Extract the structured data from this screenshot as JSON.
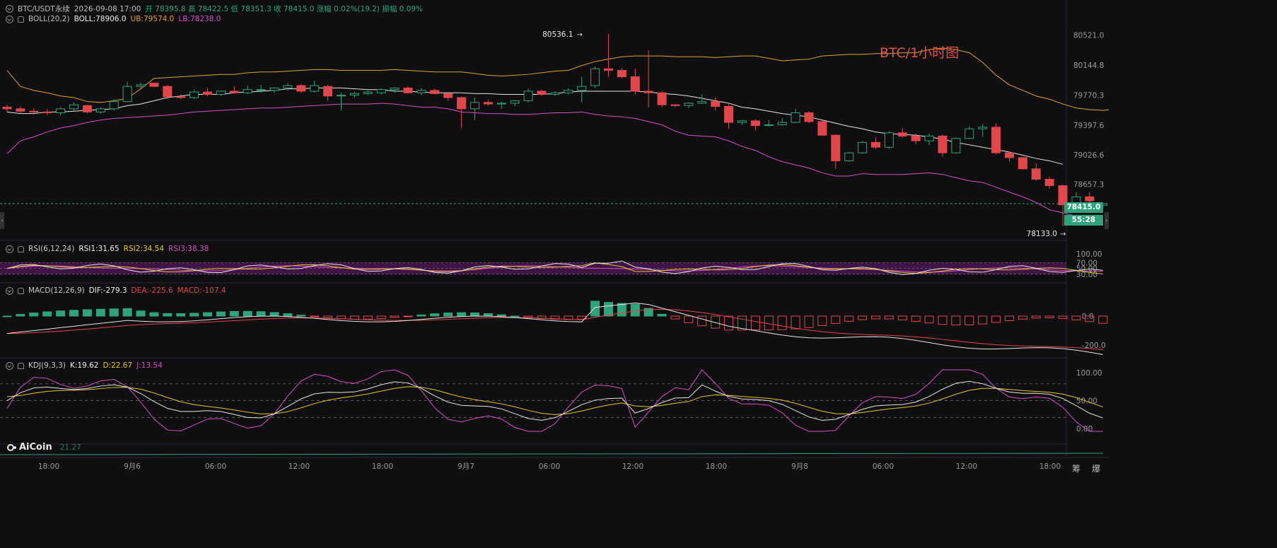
{
  "header": {
    "symbol": "BTC/USDT永续",
    "datetime": "2026-09-08 17:00",
    "ohlc_text": "开 78395.8 高 78422.5 低 78351.3 收 78415.0 涨幅 0.02%(19.2) 振幅 0.09%",
    "boll_label": "BOLL(20,2)",
    "boll_mid": "BOLL:78906.0",
    "boll_ub": "UB:79574.0",
    "boll_lb": "LB:78238.0"
  },
  "chart_title": "BTC/1小时图",
  "annotations": {
    "high": "80536.1",
    "low": "78133.0"
  },
  "price_axis_labels": [
    "80521.0",
    "80144.8",
    "79770.3",
    "79397.6",
    "79026.6",
    "78657.3"
  ],
  "current_price": "78415.0",
  "countdown": "55:28",
  "rsi": {
    "label": "RSI(6,12,24)",
    "v1": "RSI1:31.65",
    "v2": "RSI2:34.54",
    "v3": "RSI3:38.38",
    "axis": [
      "100.00",
      "70.00",
      "50.00",
      "30.00"
    ]
  },
  "macd": {
    "label": "MACD(12,26,9)",
    "dif": "DIF:-279.3",
    "dea": "DEA:-225.6",
    "macd": "MACD:-107.4",
    "axis": [
      "0.0",
      "-200.0"
    ]
  },
  "kdj": {
    "label": "KDJ(9,3,3)",
    "k": "K:19.62",
    "d": "D:22.67",
    "j": "J:13.54",
    "axis": [
      "100.00",
      "50.00",
      "0.00"
    ]
  },
  "bottom_indicator_value": "21.27",
  "time_axis": [
    "18:00",
    "9月6",
    "06:00",
    "12:00",
    "18:00",
    "9月7",
    "06:00",
    "12:00",
    "18:00",
    "9月8",
    "06:00",
    "12:00",
    "18:00"
  ],
  "logo_text": "AiCoin",
  "bottom_right_text": "筹 爆",
  "colors": {
    "up": "#2fa37a",
    "down": "#e0474c",
    "ub": "#e2a02f",
    "mid": "#e6e6e6",
    "lb": "#d74fc2",
    "rsi_band": "#4a1550"
  },
  "chart_data": {
    "type": "candlestick",
    "interval": "1h",
    "ylim": [
      78000,
      80650
    ],
    "candles": [
      [
        79620,
        79650,
        79560,
        79600
      ],
      [
        79600,
        79630,
        79540,
        79570
      ],
      [
        79570,
        79610,
        79530,
        79560
      ],
      [
        79560,
        79600,
        79520,
        79550
      ],
      [
        79550,
        79620,
        79520,
        79600
      ],
      [
        79600,
        79680,
        79570,
        79650
      ],
      [
        79640,
        79650,
        79540,
        79560
      ],
      [
        79560,
        79620,
        79540,
        79600
      ],
      [
        79600,
        79720,
        79580,
        79690
      ],
      [
        79690,
        79940,
        79680,
        79880
      ],
      [
        79880,
        79930,
        79860,
        79900
      ],
      [
        79920,
        79930,
        79870,
        79880
      ],
      [
        79880,
        79900,
        79740,
        79750
      ],
      [
        79750,
        79780,
        79720,
        79740
      ],
      [
        79740,
        79840,
        79720,
        79810
      ],
      [
        79810,
        79860,
        79760,
        79780
      ],
      [
        79780,
        79830,
        79760,
        79820
      ],
      [
        79820,
        79880,
        79790,
        79800
      ],
      [
        79800,
        79890,
        79780,
        79840
      ],
      [
        79840,
        79900,
        79800,
        79840
      ],
      [
        79830,
        79870,
        79800,
        79860
      ],
      [
        79860,
        79920,
        79830,
        79890
      ],
      [
        79890,
        79910,
        79800,
        79820
      ],
      [
        79820,
        79950,
        79800,
        79890
      ],
      [
        79880,
        79900,
        79700,
        79760
      ],
      [
        79760,
        79800,
        79580,
        79770
      ],
      [
        79770,
        79810,
        79740,
        79790
      ],
      [
        79790,
        79830,
        79770,
        79810
      ],
      [
        79800,
        79860,
        79780,
        79840
      ],
      [
        79840,
        79870,
        79800,
        79860
      ],
      [
        79860,
        79880,
        79790,
        79800
      ],
      [
        79800,
        79860,
        79770,
        79830
      ],
      [
        79830,
        79850,
        79780,
        79790
      ],
      [
        79790,
        79810,
        79700,
        79740
      ],
      [
        79740,
        79760,
        79360,
        79600
      ],
      [
        79600,
        79740,
        79460,
        79680
      ],
      [
        79680,
        79710,
        79640,
        79660
      ],
      [
        79660,
        79690,
        79600,
        79670
      ],
      [
        79670,
        79710,
        79630,
        79700
      ],
      [
        79700,
        79850,
        79680,
        79820
      ],
      [
        79820,
        79840,
        79760,
        79780
      ],
      [
        79780,
        79820,
        79760,
        79800
      ],
      [
        79800,
        79860,
        79780,
        79830
      ],
      [
        79830,
        80000,
        79680,
        79880
      ],
      [
        79890,
        80130,
        79860,
        80100
      ],
      [
        80100,
        80536,
        80000,
        80080
      ],
      [
        80080,
        80110,
        79980,
        80000
      ],
      [
        80000,
        80100,
        79780,
        79820
      ],
      [
        79820,
        80330,
        79620,
        79800
      ],
      [
        79800,
        79820,
        79620,
        79650
      ],
      [
        79650,
        79660,
        79620,
        79640
      ],
      [
        79640,
        79680,
        79610,
        79670
      ],
      [
        79670,
        79780,
        79660,
        79690
      ],
      [
        79690,
        79740,
        79580,
        79630
      ],
      [
        79630,
        79660,
        79350,
        79430
      ],
      [
        79430,
        79460,
        79400,
        79450
      ],
      [
        79450,
        79470,
        79330,
        79390
      ],
      [
        79390,
        79460,
        79380,
        79400
      ],
      [
        79400,
        79480,
        79390,
        79430
      ],
      [
        79430,
        79600,
        79420,
        79550
      ],
      [
        79550,
        79570,
        79420,
        79440
      ],
      [
        79440,
        79460,
        79260,
        79270
      ],
      [
        79270,
        79280,
        78850,
        78950
      ],
      [
        78950,
        79060,
        78940,
        79050
      ],
      [
        79050,
        79200,
        79040,
        79180
      ],
      [
        79180,
        79240,
        79100,
        79120
      ],
      [
        79120,
        79320,
        79100,
        79300
      ],
      [
        79300,
        79360,
        79240,
        79260
      ],
      [
        79260,
        79290,
        79160,
        79200
      ],
      [
        79200,
        79290,
        79150,
        79260
      ],
      [
        79260,
        79280,
        79000,
        79050
      ],
      [
        79050,
        79240,
        79040,
        79230
      ],
      [
        79230,
        79380,
        79220,
        79350
      ],
      [
        79350,
        79410,
        79250,
        79370
      ],
      [
        79370,
        79420,
        79030,
        79050
      ],
      [
        79050,
        79070,
        78940,
        78990
      ],
      [
        78990,
        79000,
        78840,
        78850
      ],
      [
        78850,
        78920,
        78700,
        78720
      ],
      [
        78720,
        78750,
        78600,
        78640
      ],
      [
        78640,
        78650,
        78133,
        78400
      ],
      [
        78400,
        78560,
        78380,
        78500
      ],
      [
        78500,
        78560,
        78370,
        78450
      ],
      [
        78395.8,
        78422.5,
        78351.3,
        78415
      ]
    ],
    "boll": {
      "ub": [
        80080,
        79880,
        79830,
        79800,
        79760,
        79740,
        79690,
        79680,
        79700,
        79730,
        79850,
        79980,
        79990,
        80000,
        80010,
        80020,
        80030,
        80030,
        80050,
        80060,
        80060,
        80070,
        80080,
        80090,
        80090,
        80080,
        80080,
        80080,
        80080,
        80090,
        80080,
        80070,
        80060,
        80060,
        80060,
        80040,
        80020,
        80010,
        80020,
        80030,
        80050,
        80070,
        80080,
        80140,
        80190,
        80220,
        80250,
        80260,
        80260,
        80260,
        80250,
        80250,
        80250,
        80240,
        80250,
        80260,
        80260,
        80230,
        80200,
        80210,
        80220,
        80260,
        80270,
        80280,
        80280,
        80290,
        80290,
        80300,
        80300,
        80340,
        80360,
        80340,
        80300,
        80180,
        80020,
        79900,
        79830,
        79760,
        79720,
        79660,
        79610,
        79590,
        79580,
        79600,
        79610,
        79640,
        79660,
        79650,
        79610,
        79590
      ],
      "mid": [
        79560,
        79540,
        79540,
        79560,
        79560,
        79570,
        79580,
        79590,
        79600,
        79640,
        79660,
        79700,
        79740,
        79760,
        79780,
        79780,
        79780,
        79800,
        79810,
        79820,
        79830,
        79850,
        79850,
        79860,
        79860,
        79860,
        79850,
        79840,
        79840,
        79820,
        79820,
        79810,
        79800,
        79800,
        79800,
        79790,
        79790,
        79780,
        79780,
        79780,
        79780,
        79790,
        79810,
        79820,
        79820,
        79820,
        79820,
        79820,
        79810,
        79790,
        79780,
        79760,
        79730,
        79700,
        79670,
        79620,
        79600,
        79570,
        79540,
        79520,
        79500,
        79460,
        79420,
        79380,
        79350,
        79310,
        79290,
        79280,
        79270,
        79250,
        79220,
        79180,
        79150,
        79120,
        79090,
        79060,
        79020,
        78980,
        78950,
        78906
      ],
      "lb": [
        79040,
        79200,
        79250,
        79310,
        79360,
        79390,
        79430,
        79460,
        79480,
        79490,
        79500,
        79510,
        79520,
        79540,
        79560,
        79570,
        79580,
        79590,
        79600,
        79610,
        79610,
        79620,
        79630,
        79640,
        79650,
        79660,
        79660,
        79660,
        79670,
        79660,
        79640,
        79620,
        79620,
        79600,
        79560,
        79550,
        79540,
        79540,
        79530,
        79530,
        79540,
        79550,
        79550,
        79560,
        79530,
        79510,
        79500,
        79480,
        79440,
        79400,
        79320,
        79270,
        79260,
        79250,
        79200,
        79130,
        79080,
        79000,
        78940,
        78900,
        78860,
        78800,
        78760,
        78760,
        78790,
        78780,
        78780,
        78780,
        78790,
        78800,
        78780,
        78740,
        78700,
        78680,
        78620,
        78560,
        78500,
        78430,
        78340,
        78300,
        78260,
        78238
      ]
    }
  }
}
